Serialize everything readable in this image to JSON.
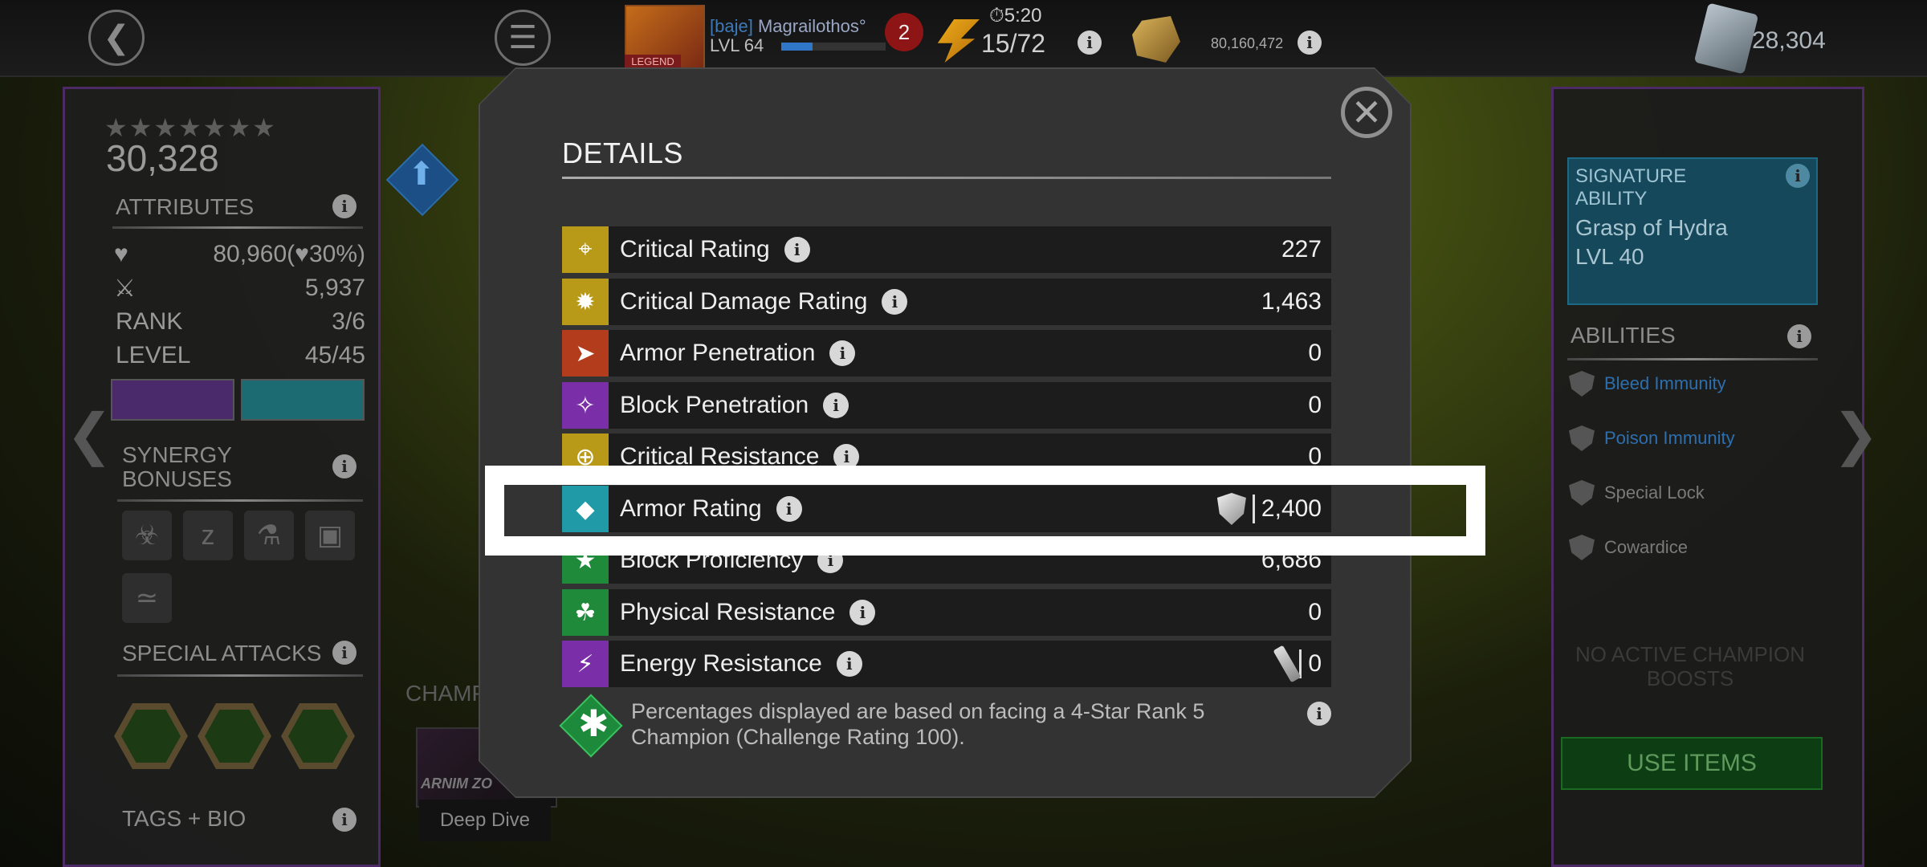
{
  "top_bar": {
    "clan_tag": "[baje]",
    "player_name": "Magrailothos°",
    "player_level": "LVL 64",
    "xp_progress": 0.3,
    "legend_tag": "LEGEND",
    "notification_count": "2",
    "energy_timer": "5:20",
    "energy": "15/72",
    "gold": "80,160,472",
    "units": "28,304"
  },
  "left_panel": {
    "stars": "★★★★★★★",
    "prestige": "30,328",
    "attributes_title": "ATTRIBUTES",
    "health": "80,960",
    "health_percent": "30%",
    "attack": "5,937",
    "rank_label": "RANK",
    "rank": "3/6",
    "level_label": "LEVEL",
    "level": "45/45",
    "synergy_title": "SYNERGY BONUSES",
    "special_attacks_title": "SPECIAL ATTACKS",
    "tags_title": "TAGS + BIO"
  },
  "center_bg": {
    "champions_label": "CHAMP",
    "card_name": "ARNIM ZO",
    "deep_dive": "Deep Dive"
  },
  "right_panel": {
    "signature_title": "SIGNATURE ABILITY",
    "signature_name": "Grasp of Hydra",
    "signature_level": "LVL 40",
    "abilities_title": "ABILITIES",
    "abilities": [
      {
        "label": "Bleed Immunity",
        "color": "#2d6fae"
      },
      {
        "label": "Poison Immunity",
        "color": "#2d6fae"
      },
      {
        "label": "Special Lock",
        "color": "#7a7a7a"
      },
      {
        "label": "Cowardice",
        "color": "#7a7a7a"
      }
    ],
    "boosts_text": "NO ACTIVE CHAMPION BOOSTS",
    "use_items": "USE ITEMS"
  },
  "modal": {
    "title": "DETAILS",
    "rows": [
      {
        "label": "Critical Rating",
        "value": "227",
        "icon": "crosshair-icon",
        "color": "#b89a18"
      },
      {
        "label": "Critical Damage Rating",
        "value": "1,463",
        "icon": "burst-icon",
        "color": "#b89a18"
      },
      {
        "label": "Armor Penetration",
        "value": "0",
        "icon": "armor-pen-icon",
        "color": "#b23c1c"
      },
      {
        "label": "Block Penetration",
        "value": "0",
        "icon": "block-pen-icon",
        "color": "#7a2fa8"
      },
      {
        "label": "Critical Resistance",
        "value": "0",
        "icon": "crit-resist-icon",
        "color": "#b89a18"
      },
      {
        "label": "Armor Rating",
        "value": "2,400",
        "icon": "shield-icon",
        "color": "#1f9aa6"
      },
      {
        "label": "Block Proficiency",
        "value": "6,686",
        "icon": "block-prof-icon",
        "color": "#1f8a3a"
      },
      {
        "label": "Physical Resistance",
        "value": "0",
        "icon": "physical-resist-icon",
        "color": "#1f8a3a"
      },
      {
        "label": "Energy Resistance",
        "value": "0",
        "icon": "energy-resist-icon",
        "color": "#7a2fa8"
      }
    ],
    "footnote": "Percentages displayed are based on facing a 4-Star Rank 5 Champion (Challenge Rating 100)."
  }
}
